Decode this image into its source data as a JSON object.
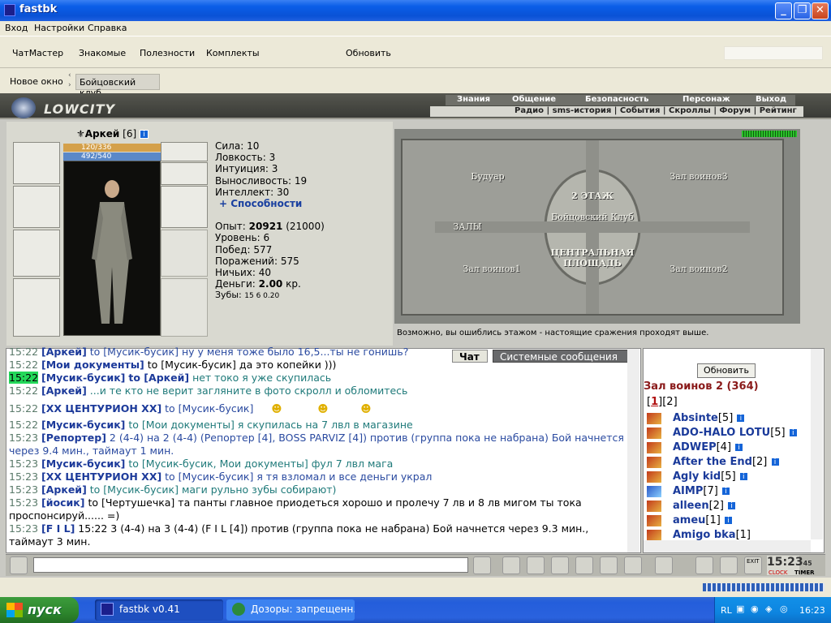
{
  "window": {
    "title": "fastbk",
    "minimize": "_",
    "maximize": "❐",
    "close": "✕"
  },
  "menubar": [
    "Вход",
    "Настройки",
    "Справка"
  ],
  "toolbar": [
    "ЧатМастер",
    "Знакомые",
    "Полезности",
    "Комплекты",
    "Обновить"
  ],
  "tabs": {
    "new_window": "Новое окно",
    "active_tab": "Бойцовский клуб"
  },
  "game_nav": {
    "logo": "LOWCITY",
    "top_menu": [
      "Знания",
      "Общение",
      "Безопасность",
      "Персонаж",
      "Выход"
    ],
    "sub_menu": "Радио | sms-история | События | Скроллы | Форум | Рейтинг"
  },
  "character": {
    "name": "Аркей",
    "level": "[6]",
    "hp": "120/336",
    "mana": "492/540",
    "stats": [
      {
        "label": "Сила:",
        "value": "10"
      },
      {
        "label": "Ловкость:",
        "value": "3"
      },
      {
        "label": "Интуиция:",
        "value": "3"
      },
      {
        "label": "Выносливость:",
        "value": "19"
      },
      {
        "label": "Интеллект:",
        "value": "30"
      }
    ],
    "abilities_link": "+ Способности",
    "experience_label": "Опыт:",
    "experience": "20921",
    "experience_next": "(21000)",
    "level_label": "Уровень:",
    "level_value": "6",
    "wins_label": "Побед:",
    "wins": "577",
    "losses_label": "Поражений:",
    "losses": "575",
    "draws_label": "Ничьих:",
    "draws": "40",
    "money_label": "Деньги:",
    "money": "2.00",
    "money_unit": "кр.",
    "teeth_label": "Зубы:",
    "teeth": "15 6 0.20"
  },
  "map": {
    "floor": "2 ЭТАЖ",
    "rooms": {
      "boudoir": "Будуар",
      "hall3": "Зал воинов3",
      "halls": "ЗАЛЫ",
      "club": "Бойцовский Клуб",
      "square": "ЦЕНТРАЛЬНАЯ ПЛОЩАДЬ",
      "hall1": "Зал воинов1",
      "hall2": "Зал воинов2"
    },
    "note": "Возможно, вы ошиблись этажом - настоящие сражения проходят выше."
  },
  "chat_tabs": [
    "Чат",
    "Системные сообщения"
  ],
  "chat": [
    {
      "time": "15:22",
      "nick": "[Аркей]",
      "to": "to [Мусик-бусик]",
      "text": "ну у меня тоже было 16,5...ты не гонишь?"
    },
    {
      "time": "15:22",
      "nick": "[Мои документы]",
      "to": "to [Мусик-бусик]",
      "text": "да это копейки )))"
    },
    {
      "time": "15:22",
      "nick": "[Мусик-бусик]",
      "to": "to [Аркей]",
      "text": "нет токо я уже скупилась"
    },
    {
      "time": "15:22",
      "nick": "[Аркей]",
      "to": "",
      "text": "...и те кто не верит загляните в фото скролл и обломитесь"
    },
    {
      "time": "15:22",
      "nick": "[XX ЦЕНТУРИОН XX]",
      "to": "to [Мусик-бусик]",
      "text": ""
    },
    {
      "time": "15:22",
      "nick": "[Мусик-бусик]",
      "to": "to [Мои документы]",
      "text": "я скупилась на 7 лвл в магазине"
    },
    {
      "time": "15:23",
      "nick": "[Репортер]",
      "to": "",
      "text": "2 (4-4) на 2 (4-4) (Репортер [4], BOSS PARVIZ [4]) против (группа пока не набрана) Бой начнется через 9.4 мин., таймаут 1 мин."
    },
    {
      "time": "15:23",
      "nick": "[Мусик-бусик]",
      "to": "to [Мусик-бусик, Мои документы]",
      "text": "фул 7 лвл мага"
    },
    {
      "time": "15:23",
      "nick": "[XX ЦЕНТУРИОН XX]",
      "to": "to [Мусик-бусик]",
      "text": "я тя взломал и все деньги украл"
    },
    {
      "time": "15:23",
      "nick": "[Аркей]",
      "to": "to [Мусик-бусик]",
      "text": "маги рульно зубы собирают)"
    },
    {
      "time": "15:23",
      "nick": "[йосик]",
      "to": "to [Чертушечка]",
      "text": "та панты главное приодеться хорошо и пролечу 7 лв и 8 лв мигом ты тока проспонсируй...... =)"
    },
    {
      "time": "15:23",
      "nick": "[F I L]",
      "to": "",
      "text": "15:22 3 (4-4) на 3 (4-4) (F I L [4]) против (группа пока не набрана) Бой начнется через 9.3 мин., таймаут 3 мин."
    }
  ],
  "room_panel": {
    "refresh": "Обновить",
    "title": "Зал воинов 2 (364)",
    "pages": [
      "1",
      "2"
    ],
    "users": [
      {
        "name": "Absinte",
        "level": "[5]"
      },
      {
        "name": "ADO-HALO LOTU",
        "level": "[5]"
      },
      {
        "name": "ADWEP",
        "level": "[4]"
      },
      {
        "name": "After the End",
        "level": "[2]"
      },
      {
        "name": "Agly kid",
        "level": "[5]"
      },
      {
        "name": "AIMP",
        "level": "[7]"
      },
      {
        "name": "alleen",
        "level": "[2]"
      },
      {
        "name": "ameu",
        "level": "[1]"
      },
      {
        "name": "Amigo bka",
        "level": "[1]"
      }
    ]
  },
  "bottom": {
    "clock": "15:23",
    "clock_sub": "45",
    "clock_label": "CLOCK",
    "timer_label": "TIMER",
    "exit_label": "EXIT"
  },
  "taskbar": {
    "start": "пуск",
    "tasks": [
      "fastbk v0.41",
      "Дозоры: запрещенн..."
    ],
    "lang": "RL",
    "time": "16:23"
  }
}
